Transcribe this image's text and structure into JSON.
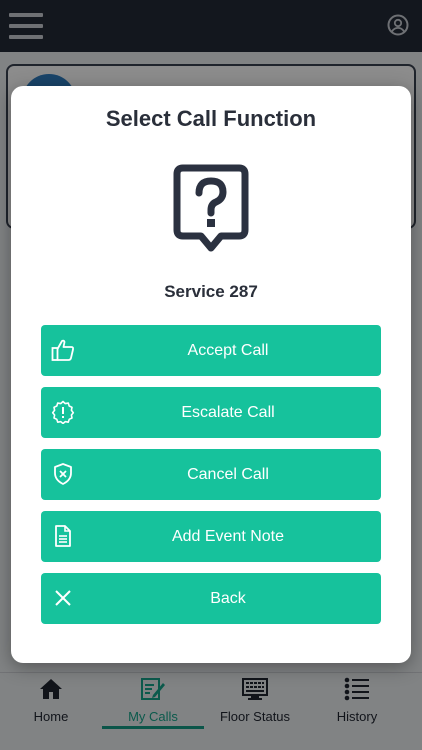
{
  "header": {
    "menu_icon": "hamburger-menu-icon",
    "profile_icon": "user-circle-icon"
  },
  "modal": {
    "title": "Select Call Function",
    "icon": "question-bubble-icon",
    "service": "Service 287",
    "actions": [
      {
        "label": "Accept Call",
        "icon": "thumbs-up-icon"
      },
      {
        "label": "Escalate Call",
        "icon": "alert-badge-icon"
      },
      {
        "label": "Cancel Call",
        "icon": "shield-x-icon"
      },
      {
        "label": "Add Event Note",
        "icon": "document-icon"
      },
      {
        "label": "Back",
        "icon": "close-icon"
      }
    ]
  },
  "bottom_nav": {
    "items": [
      {
        "label": "Home",
        "icon": "home-icon"
      },
      {
        "label": "My Calls",
        "icon": "edit-note-icon",
        "active": true
      },
      {
        "label": "Floor Status",
        "icon": "monitor-grid-icon"
      },
      {
        "label": "History",
        "icon": "list-icon"
      }
    ]
  },
  "colors": {
    "accent": "#16c29c",
    "topbar": "#232b38",
    "active_tab": "#17a58a"
  }
}
